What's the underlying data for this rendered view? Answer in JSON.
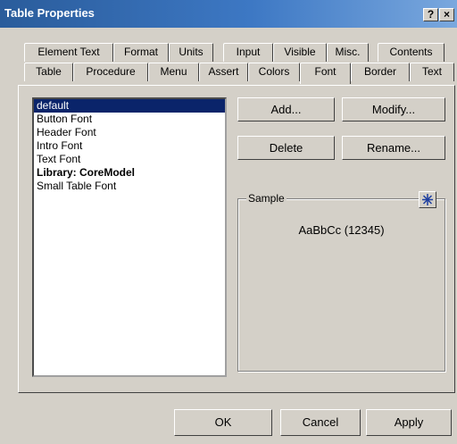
{
  "window": {
    "title": "Table Properties",
    "help_glyph": "?",
    "close_glyph": "×"
  },
  "tabs_row1": [
    "Element Text",
    "Format",
    "Units",
    "Input",
    "Visible",
    "Misc.",
    "Contents"
  ],
  "tabs_row2": [
    "Table",
    "Procedure",
    "Menu",
    "Assert",
    "Colors",
    "Font",
    "Border",
    "Text"
  ],
  "active_tab": "Font",
  "font_list": {
    "items": [
      {
        "label": "default",
        "selected": true,
        "bold": false
      },
      {
        "label": "Button Font",
        "selected": false,
        "bold": false
      },
      {
        "label": "Header Font",
        "selected": false,
        "bold": false
      },
      {
        "label": "Intro Font",
        "selected": false,
        "bold": false
      },
      {
        "label": "Text Font",
        "selected": false,
        "bold": false
      },
      {
        "label": "Library: CoreModel",
        "selected": false,
        "bold": true
      },
      {
        "label": "Small Table Font",
        "selected": false,
        "bold": false
      }
    ]
  },
  "buttons": {
    "add": "Add...",
    "modify": "Modify...",
    "delete": "Delete",
    "rename": "Rename..."
  },
  "sample": {
    "label": "Sample",
    "text": "AaBbCc (12345)",
    "color_button_icon": "asterisk-icon"
  },
  "footer": {
    "ok": "OK",
    "cancel": "Cancel",
    "apply": "Apply"
  },
  "colors": {
    "title_bar": "#2a5c9b",
    "face": "#d4d0c8",
    "selection": "#0a246a",
    "accent_icon": "#1e3fa0"
  }
}
